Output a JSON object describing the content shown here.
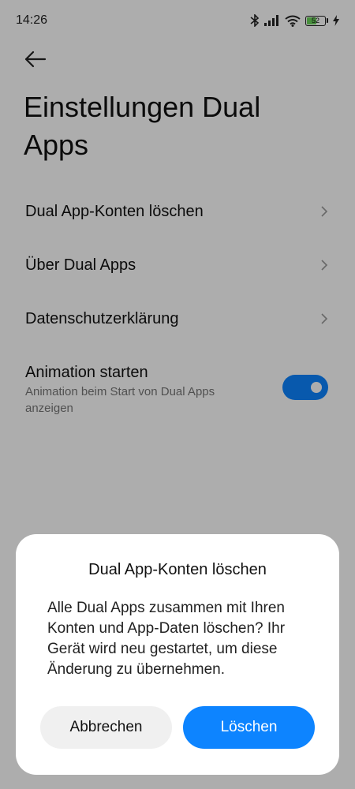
{
  "status_bar": {
    "time": "14:26",
    "battery_level": "52",
    "icons": [
      "bluetooth-icon",
      "signal-icon",
      "wifi-icon",
      "battery-icon",
      "charging-icon"
    ]
  },
  "header": {
    "back_icon": "arrow-left-icon",
    "title": "Einstellungen Dual Apps"
  },
  "settings": {
    "items": [
      {
        "label": "Dual App-Konten löschen"
      },
      {
        "label": "Über Dual Apps"
      },
      {
        "label": "Datenschutzerklärung"
      }
    ],
    "toggle": {
      "title": "Animation starten",
      "subtitle": "Animation beim Start von Dual Apps anzeigen",
      "enabled": true
    }
  },
  "dialog": {
    "title": "Dual App-Konten löschen",
    "message": "Alle Dual Apps zusammen mit Ihren Konten und App-Daten löschen? Ihr Gerät wird neu gestartet, um diese Änderung zu übernehmen.",
    "cancel_label": "Abbrechen",
    "confirm_label": "Löschen"
  },
  "colors": {
    "accent": "#0d84ff",
    "scrim": "rgba(0,0,0,0.32)",
    "battery": "#6bd35b"
  }
}
